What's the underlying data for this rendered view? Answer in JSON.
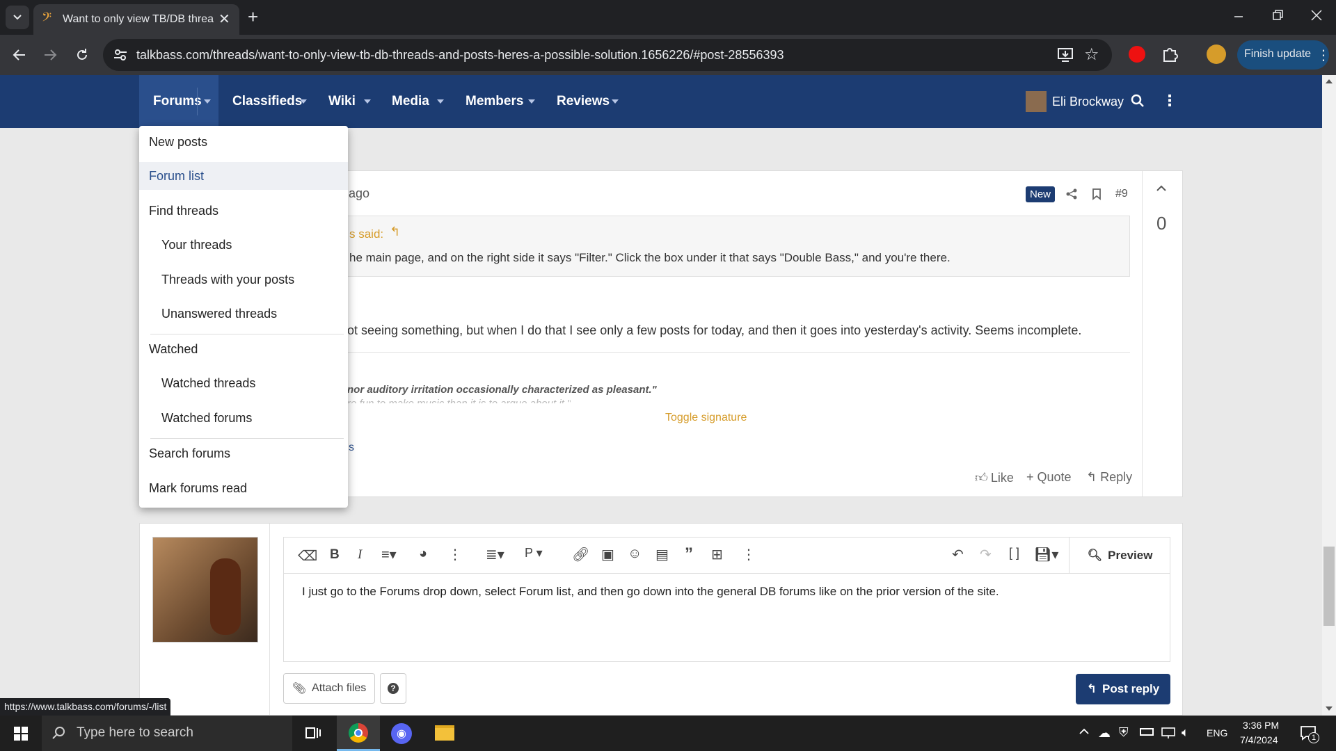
{
  "browser": {
    "tab_title": "Want to only view TB/DB threa",
    "url": "talkbass.com/threads/want-to-only-view-tb-db-threads-and-posts-heres-a-possible-solution.1656226/#post-28556393",
    "finish_update_label": "Finish update",
    "status_url": "https://www.talkbass.com/forums/-/list"
  },
  "nav": {
    "items": [
      {
        "label": "Forums"
      },
      {
        "label": "Classifieds"
      },
      {
        "label": "Wiki"
      },
      {
        "label": "Media"
      },
      {
        "label": "Members"
      },
      {
        "label": "Reviews"
      }
    ],
    "user_name": "Eli Brockway"
  },
  "forums_menu": {
    "items": [
      {
        "label": "New posts"
      },
      {
        "label": "Forum list"
      },
      {
        "label": "Find threads"
      },
      {
        "label": "Your threads"
      },
      {
        "label": "Threads with your posts"
      },
      {
        "label": "Unanswered threads"
      },
      {
        "label": "Watched"
      },
      {
        "label": "Watched threads"
      },
      {
        "label": "Watched forums"
      },
      {
        "label": "Search forums"
      },
      {
        "label": "Mark forums read"
      }
    ]
  },
  "post": {
    "time_fragment": "ago",
    "new_badge": "New",
    "post_number": "#9",
    "vote_count": "0",
    "quote_author_fragment": "s said:",
    "quote_text": "he main page, and on the right side it says \"Filter.\" Click the box under it that says \"Double Bass,\" and you're there.",
    "body": "ot seeing something, but when I do that I see only a few posts for today, and then it goes into yesterday's activity. Seems incomplete.",
    "signature_line1": "nor auditory irritation occasionally characterized as pleasant.\"",
    "signature_line2": "re fun to make music than it is to argue about it.\"",
    "toggle_signature": "Toggle signature",
    "reactions_fragment": "s",
    "like_label": "Like",
    "quote_label": "Quote",
    "reply_label": "Reply"
  },
  "editor": {
    "text": "I just go to the Forums drop down, select Forum list, and then go down into the general DB forums like on the prior version of the site.",
    "preview_label": "Preview",
    "attach_label": "Attach files",
    "help_label": "?",
    "post_reply_label": "Post reply"
  },
  "taskbar": {
    "search_placeholder": "Type here to search",
    "language": "ENG",
    "time": "3:36 PM",
    "date": "7/4/2024",
    "notification_count": "1"
  },
  "colors": {
    "site_nav": "#1c3c72",
    "accent_orange": "#d69c2a",
    "new_badge": "#1c3c72",
    "post_reply_button": "#1c3c72"
  }
}
